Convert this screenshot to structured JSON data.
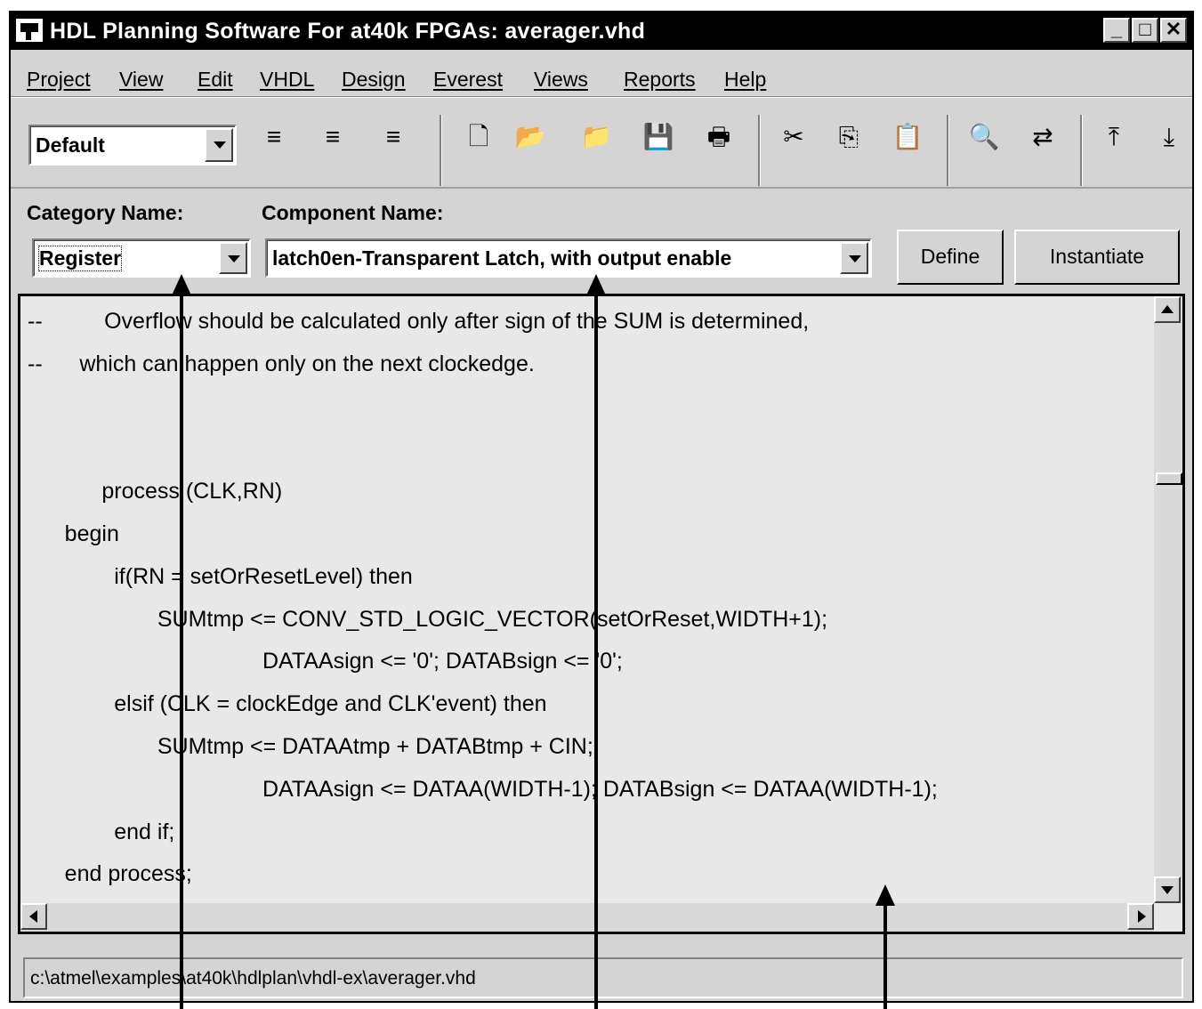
{
  "window": {
    "title": "HDL Planning Software For at40k FPGAs: averager.vhd",
    "controls": [
      "_",
      "□",
      "✕"
    ]
  },
  "menu": [
    "Project",
    "View",
    "Edit",
    "VHDL",
    "Design",
    "Everest",
    "Views",
    "Reports",
    "Help"
  ],
  "toolbar": {
    "style_combo_value": "Default",
    "icons": {
      "align_left": "≡",
      "align_center": "≡",
      "align_right": "≡",
      "new": "🗋",
      "open": "📂",
      "open_up": "📁",
      "save": "💾",
      "print": "🖶",
      "cut": "✂",
      "copy": "⎘",
      "paste": "📋",
      "find": "🔍",
      "replace": "⇄",
      "move_top": "⤒",
      "move_bottom": "⤓"
    }
  },
  "selectors": {
    "category_label": "Category Name:",
    "category_value": "Register",
    "component_label": "Component Name:",
    "component_value": "latch0en-Transparent Latch, with output enable",
    "define_label": "Define",
    "instantiate_label": "Instantiate"
  },
  "editor": {
    "lines": [
      "--          Overflow should be calculated only after sign of the SUM is determined,",
      "--      which can happen only on the next clockedge.",
      "",
      "",
      "            process (CLK,RN)",
      "      begin",
      "              if(RN = setOrResetLevel) then",
      "                     SUMtmp <= CONV_STD_LOGIC_VECTOR(setOrReset,WIDTH+1);",
      "                                      DATAAsign <= '0'; DATABsign <= '0';",
      "              elsif (CLK = clockEdge and CLK'event) then",
      "                     SUMtmp <= DATAAtmp + DATABtmp + CIN;",
      "                                      DATAAsign <= DATAA(WIDTH-1); DATABsign <= DATAA(WIDTH-1);",
      "              end if;",
      "      end process;"
    ]
  },
  "status": {
    "path": "c:\\atmel\\examples\\at40k\\hdlplan\\vhdl-ex\\averager.vhd"
  }
}
